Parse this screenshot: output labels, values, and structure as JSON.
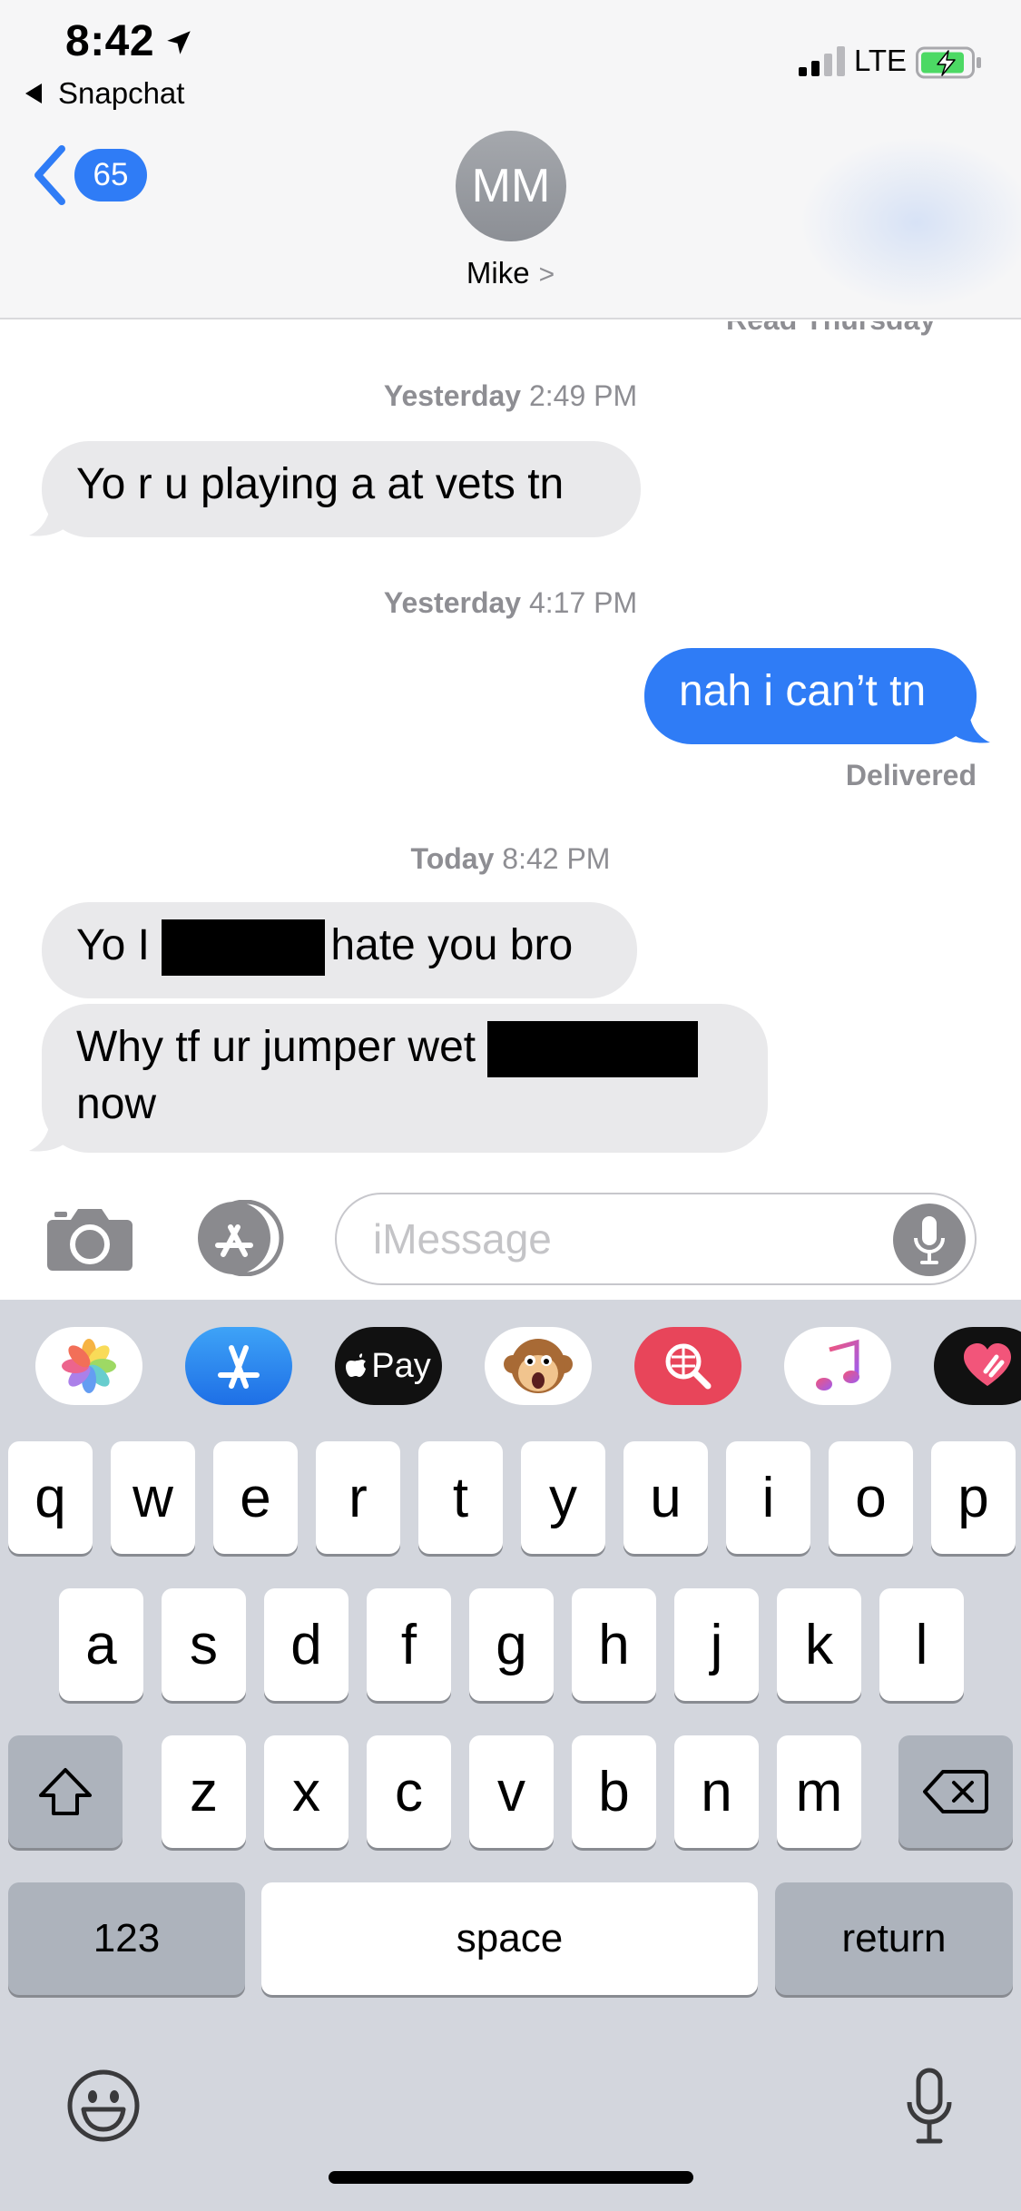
{
  "status": {
    "time": "8:42",
    "back_app": "Snapchat",
    "network": "LTE",
    "icons": [
      "location-arrow-icon",
      "signal-bars-icon",
      "battery-charging-icon"
    ]
  },
  "header": {
    "unread_count": "65",
    "avatar_initials": "MM",
    "contact_name": "Mike",
    "contact_chevron": ">"
  },
  "thread": {
    "read_receipt_cut": "Read Thursday",
    "timestamps": [
      {
        "day": "Yesterday",
        "time": " 2:49 PM"
      },
      {
        "day": "Yesterday",
        "time": " 4:17 PM"
      },
      {
        "day": "Today",
        "time": " 8:42 PM"
      }
    ],
    "messages": [
      {
        "direction": "incoming",
        "text": "Yo r u playing a at vets tn"
      },
      {
        "direction": "outgoing",
        "text": "nah i can’t tn"
      },
      {
        "direction": "incoming",
        "text_before": "Yo I ",
        "redacted": true,
        "text_after": "hate you bro"
      },
      {
        "direction": "incoming",
        "text_line1": "Why tf ur jumper wet ",
        "redacted": true,
        "text_line2": "now"
      }
    ],
    "delivered": "Delivered"
  },
  "compose": {
    "placeholder": "iMessage",
    "value": ""
  },
  "app_drawer": {
    "apps": [
      "photos-icon",
      "app-store-icon",
      "apple-pay-icon",
      "animoji-icon",
      "web-images-icon",
      "music-icon",
      "digital-touch-icon"
    ],
    "apple_pay_label": "Pay"
  },
  "keyboard": {
    "row1": [
      "q",
      "w",
      "e",
      "r",
      "t",
      "y",
      "u",
      "i",
      "o",
      "p"
    ],
    "row2": [
      "a",
      "s",
      "d",
      "f",
      "g",
      "h",
      "j",
      "k",
      "l"
    ],
    "row3": [
      "z",
      "x",
      "c",
      "v",
      "b",
      "n",
      "m"
    ],
    "numbers": "123",
    "space": "space",
    "return": "return"
  },
  "colors": {
    "imessage_blue": "#2f7cf6",
    "incoming_gray": "#e9e9eb",
    "keyboard_bg": "#d3d6dd"
  }
}
